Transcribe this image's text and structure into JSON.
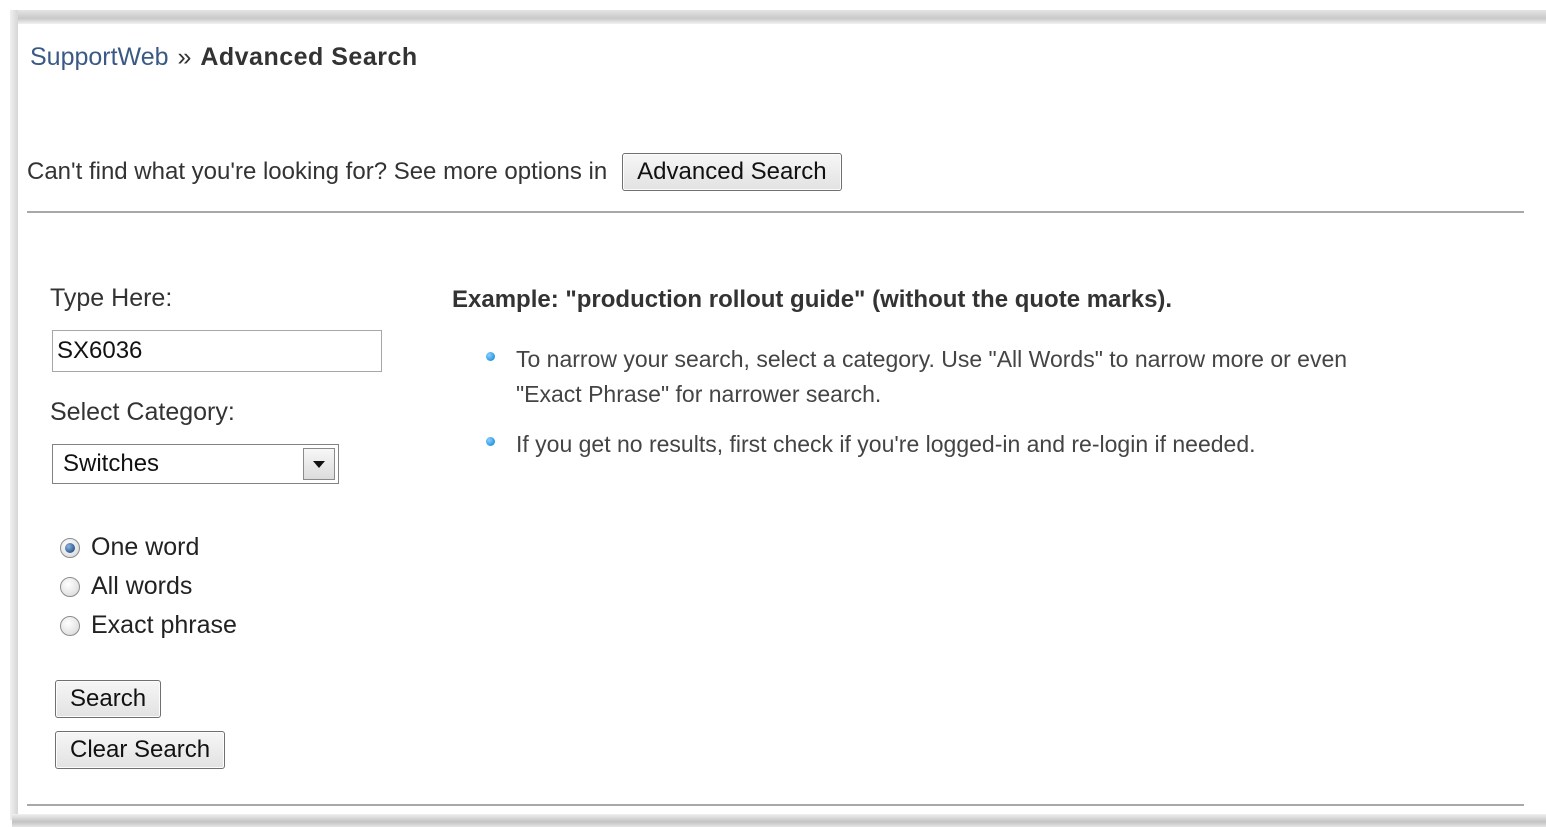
{
  "breadcrumb": {
    "root": "SupportWeb",
    "separator": "»",
    "current": "Advanced Search"
  },
  "advanced": {
    "prompt": "Can't find what you're looking for? See more options in",
    "button_label": "Advanced Search"
  },
  "form": {
    "type_here_label": "Type Here:",
    "query_value": "SX6036",
    "category_label": "Select Category:",
    "category_selected": "Switches",
    "match_options": [
      {
        "label": "One word",
        "checked": true
      },
      {
        "label": "All words",
        "checked": false
      },
      {
        "label": "Exact phrase",
        "checked": false
      }
    ],
    "search_label": "Search",
    "clear_label": "Clear Search"
  },
  "help": {
    "example": "Example: \"production rollout guide\" (without the quote marks).",
    "tips": [
      "To narrow your search, select a category. Use \"All Words\" to narrow more or even \"Exact Phrase\" for narrower search.",
      "If you get no results, first check if you're logged-in and re-login if needed."
    ]
  },
  "colors": {
    "link": "#3a5a85",
    "bullet": "#1c8fde",
    "radio_selected": "#2d5c95"
  },
  "icons": [
    "chevron-down-icon",
    "bullet-icon",
    "radio-icon"
  ]
}
